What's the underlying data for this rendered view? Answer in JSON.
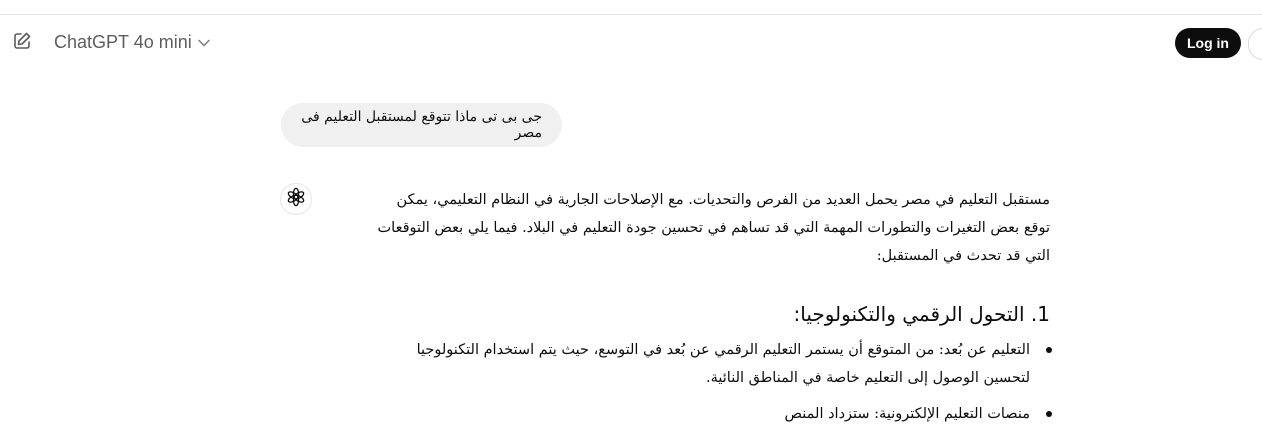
{
  "header": {
    "model_name": "ChatGPT 4o mini",
    "login_label": "Log in"
  },
  "conversation": {
    "user_message": "جى بى تى ماذا تتوقع لمستقبل التعليم فى مصر",
    "assistant": {
      "intro": "مستقبل التعليم في مصر يحمل العديد من الفرص والتحديات. مع الإصلاحات الجارية في النظام التعليمي، يمكن توقع بعض التغيرات والتطورات المهمة التي قد تساهم في تحسين جودة التعليم في البلاد. فيما يلي بعض التوقعات التي قد تحدث في المستقبل:",
      "section_heading": "1. التحول الرقمي والتكنولوجيا:",
      "bullets": [
        {
          "text": "التعليم عن بُعد: من المتوقع أن يستمر التعليم الرقمي عن بُعد في التوسع، حيث يتم استخدام التكنولوجيا لتحسين الوصول إلى التعليم خاصة في المناطق النائية."
        },
        {
          "text": "منصات التعليم الإلكترونية: ستزداد المنص"
        }
      ]
    }
  }
}
